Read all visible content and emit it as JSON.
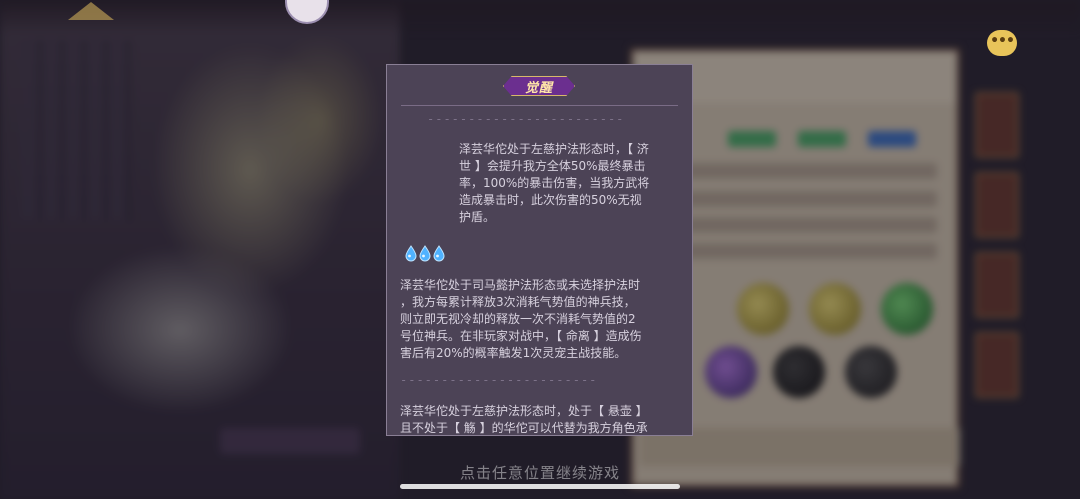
{
  "dialog": {
    "title": "觉醒",
    "divider": "------------------------",
    "sections": [
      {
        "lines": [
          "泽芸华佗处于左慈护法形态时，【 济",
          "世 】会提升我方全体50%最终暴击",
          "率，100%的暴击伤害，当我方武将",
          "造成暴击时，此次伤害的50%无视",
          "护盾。"
        ]
      },
      {
        "lines": [
          "泽芸华佗处于司马懿护法形态或未选择护法时",
          "，我方每累计释放3次消耗气势值的神兵技，",
          "则立即无视冷却的释放一次不消耗气势值的2",
          "号位神兵。在非玩家对战中，【 命离 】造成伤",
          "害后有20%的概率触发1次灵宠主战技能。"
        ]
      },
      {
        "lines": [
          "泽芸华佗处于左慈护法形态时，处于【 悬壶 】",
          "且不处于【 觞 】的华佗可以代替为我方角色承"
        ]
      }
    ],
    "icon": "blue-water-drop-icon",
    "icon_count": 3
  },
  "footer": {
    "continue_hint": "点击任意位置继续游戏"
  },
  "colors": {
    "panel_bg": "#4c4356",
    "title_badge": "#6b2f8f",
    "title_text": "#ffe6a8",
    "body_text": "#d7d1de",
    "drop_blue": "#4fb2ff"
  }
}
